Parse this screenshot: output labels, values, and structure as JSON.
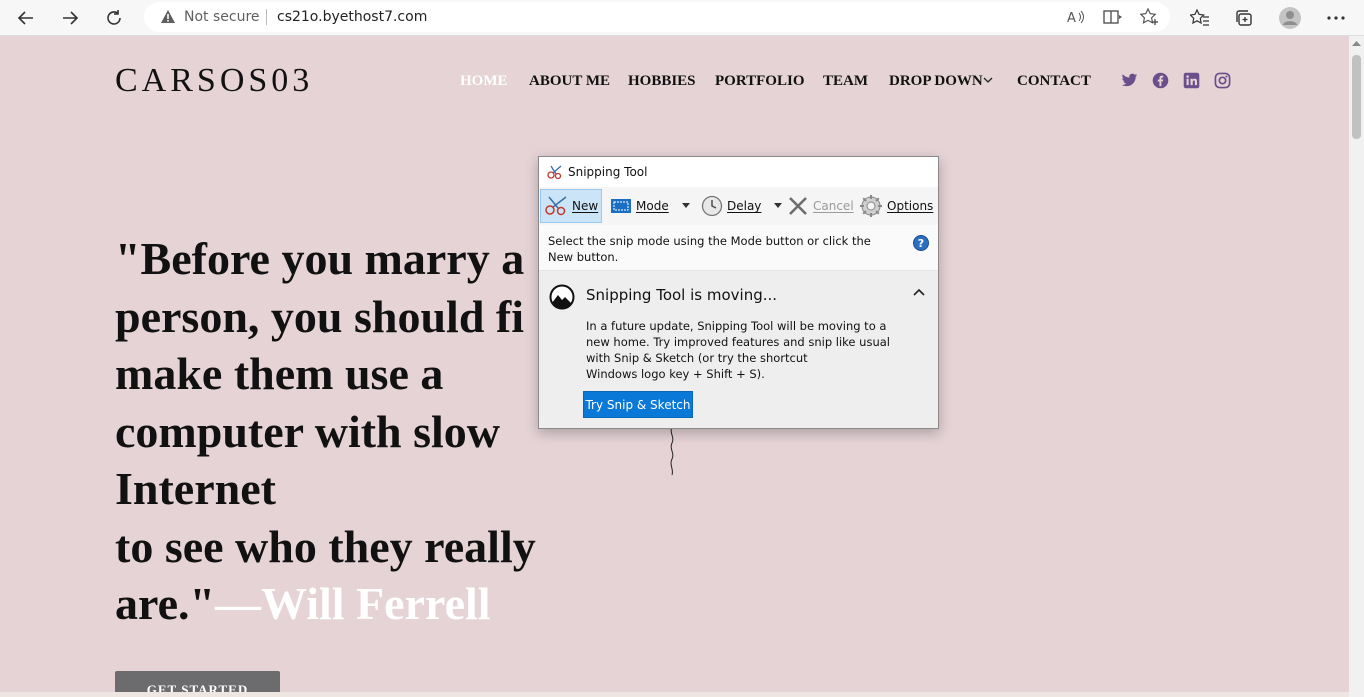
{
  "browser": {
    "security_label": "Not secure",
    "url": "cs21o.byethost7.com"
  },
  "site": {
    "logo": "CARSOS03",
    "nav": [
      "HOME",
      "ABOUT ME",
      "HOBBIES",
      "PORTFOLIO",
      "TEAM",
      "DROP DOWN",
      "CONTACT"
    ],
    "social": [
      "twitter-icon",
      "facebook-icon",
      "linkedin-icon",
      "instagram-icon"
    ],
    "quote_lines": [
      "\"Before you marry a",
      "person, you should fi",
      "make them use a",
      "computer with slow",
      "Internet",
      "to see who they really",
      "are.\""
    ],
    "author": "—Will Ferrell",
    "cta": "GET STARTED"
  },
  "snipping_tool": {
    "title": "Snipping Tool",
    "toolbar": {
      "new": "New",
      "mode": "Mode",
      "delay": "Delay",
      "cancel": "Cancel",
      "options": "Options"
    },
    "info": "Select the snip mode using the Mode button or click the New button.",
    "banner_title": "Snipping Tool is moving...",
    "banner_body": "In a future update, Snipping Tool will be moving to a new home. Try improved features and snip like usual with Snip & Sketch (or try the shortcut\nWindows logo key + Shift + S).",
    "banner_button": "Try Snip & Sketch"
  },
  "colors": {
    "page_bg": "#e5d3d6",
    "nav_active": "#ffffff",
    "social_icons": "#6a4f8a",
    "cta_bg": "#6c6c6e",
    "snip_button": "#0a78d7"
  }
}
